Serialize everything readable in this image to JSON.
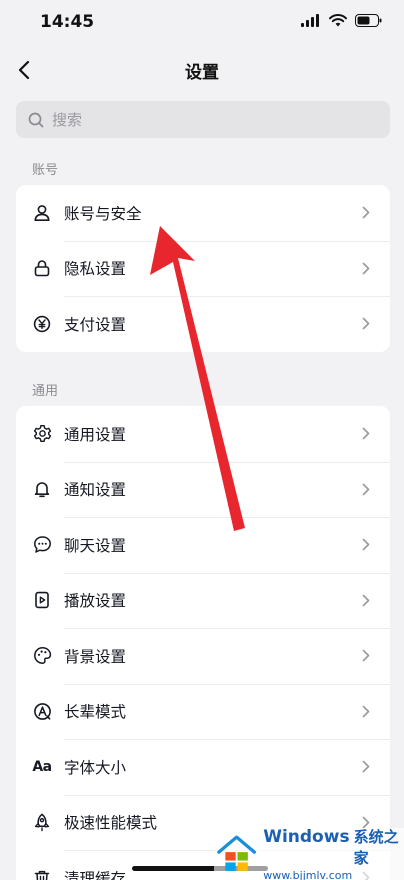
{
  "status": {
    "time": "14:45"
  },
  "nav": {
    "title": "设置"
  },
  "search": {
    "placeholder": "搜索"
  },
  "sections": {
    "account": {
      "label": "账号",
      "items": [
        {
          "label": "账号与安全",
          "icon": "person-icon"
        },
        {
          "label": "隐私设置",
          "icon": "lock-icon"
        },
        {
          "label": "支付设置",
          "icon": "yen-icon"
        }
      ]
    },
    "general": {
      "label": "通用",
      "items": [
        {
          "label": "通用设置",
          "icon": "gear-icon"
        },
        {
          "label": "通知设置",
          "icon": "bell-icon"
        },
        {
          "label": "聊天设置",
          "icon": "chat-bubble-icon"
        },
        {
          "label": "播放设置",
          "icon": "play-file-icon"
        },
        {
          "label": "背景设置",
          "icon": "palette-icon"
        },
        {
          "label": "长辈模式",
          "icon": "elder-mode-icon"
        },
        {
          "label": "字体大小",
          "icon": "font-size-icon",
          "glyph": "Aa"
        },
        {
          "label": "极速性能模式",
          "icon": "rocket-icon"
        },
        {
          "label": "清理缓存",
          "icon": "trash-icon"
        }
      ]
    }
  },
  "watermark": {
    "brand": "Windows",
    "brand_cn": "系统之家",
    "url": "www.bjjmlv.com"
  },
  "colors": {
    "background": "#f2f2f4",
    "card": "#ffffff",
    "arrow": "#e8262d",
    "watermark": "#1a5fb4"
  }
}
